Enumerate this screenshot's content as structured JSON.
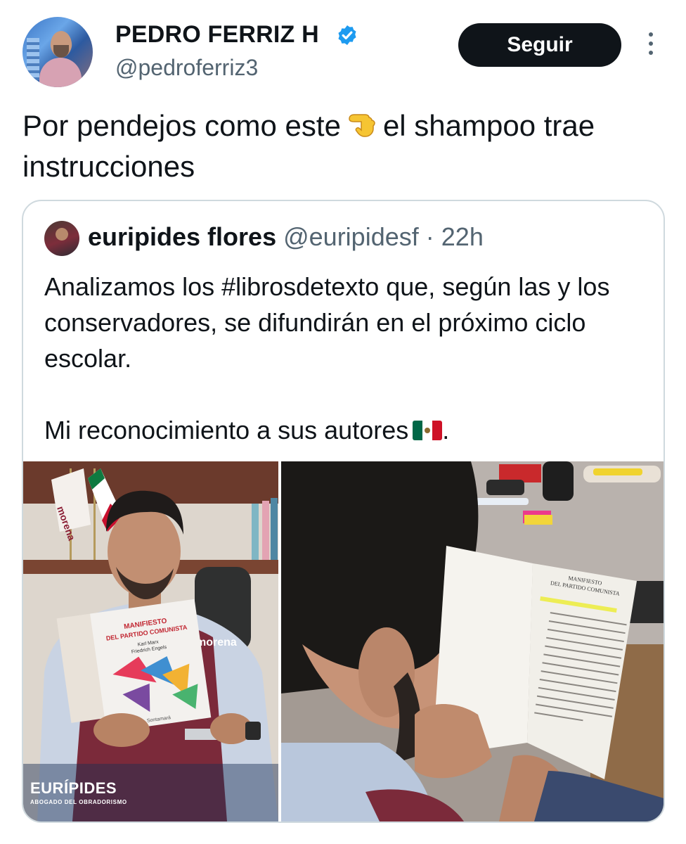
{
  "author": {
    "display_name": "PEDRO FERRIZ H",
    "handle": "@pedroferriz3",
    "verified": true,
    "verified_color": "#1d9bf0"
  },
  "follow_button": {
    "label": "Seguir"
  },
  "tweet": {
    "text_before_emoji": "Por pendejos como este",
    "emoji": "pointing-down-hand-icon",
    "text_after_emoji": "el shampoo trae instrucciones"
  },
  "quoted_tweet": {
    "display_name": "euripides flores",
    "handle": "@euripidesf",
    "separator": "·",
    "time": "22h",
    "paragraph_1": "Analizamos los #librosdetexto que, según las y los conservadores, se difundirán en el próximo ciclo escolar.",
    "paragraph_2": "Mi reconocimiento a sus autores",
    "paragraph_2_emoji": "mexico-flag-icon",
    "paragraph_2_end": ".",
    "images": [
      {
        "book_title_line1": "MANIFIESTO",
        "book_title_line2": "DEL PARTIDO COMUNISTA",
        "book_authors_1": "Karl Marx",
        "book_authors_2": "Friedrich Engels",
        "book_publisher": "Sontamará",
        "flag_text": "morena",
        "vest_text": "morena",
        "watermark_title": "EURÍPIDES",
        "watermark_subtitle": "ABOGADO DEL OBRADORISMO"
      },
      {
        "page_heading_1": "MANIFIESTO",
        "page_heading_2": "DEL PARTIDO COMUNISTA"
      }
    ]
  },
  "colors": {
    "text": "#0f1419",
    "secondary_text": "#536471",
    "border": "#cfd9de",
    "button_bg": "#0f1419"
  }
}
